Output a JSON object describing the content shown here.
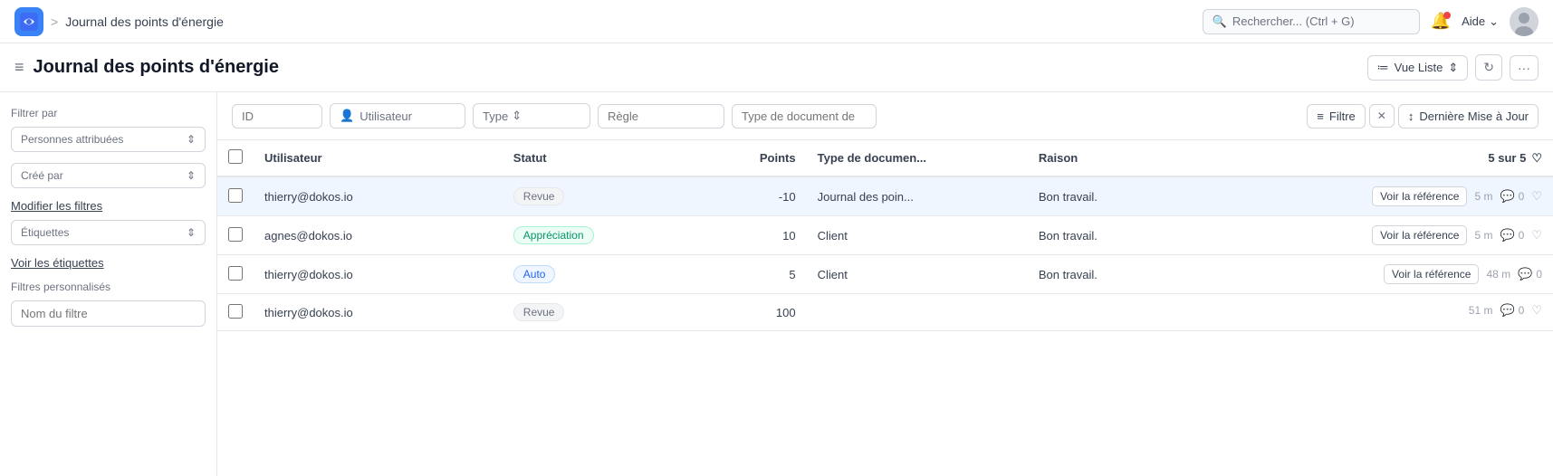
{
  "topnav": {
    "logo_text": "D",
    "breadcrumb_sep": ">",
    "breadcrumb_title": "Journal des points d'énergie",
    "search_placeholder": "Rechercher... (Ctrl + G)",
    "aide_label": "Aide",
    "bell_icon": "🔔",
    "chevron_down": "⌄"
  },
  "page_header": {
    "hamburger": "≡",
    "title": "Journal des points d'énergie",
    "view_btn_icon": "≔",
    "view_btn_label": "Vue Liste",
    "view_btn_chevron": "⇕",
    "refresh_icon": "↻",
    "more_icon": "···"
  },
  "sidebar": {
    "filter_label": "Filtrer par",
    "personne_btn": "Personnes attribuées",
    "personne_chevron": "⇕",
    "cree_par_btn": "Créé par",
    "cree_par_chevron": "⇕",
    "modifier_filtres": "Modifier les filtres",
    "etiquettes_btn": "Étiquettes",
    "etiquettes_chevron": "⇕",
    "voir_etiquettes": "Voir les étiquettes",
    "filtres_perso_label": "Filtres personnalisés",
    "nom_filtre_placeholder": "Nom du filtre"
  },
  "filter_bar": {
    "id_placeholder": "ID",
    "utilisateur_placeholder": "Utilisateur",
    "utilisateur_icon": "👤",
    "type_placeholder": "Type",
    "type_chevron": "⇕",
    "regle_placeholder": "Règle",
    "type_doc_placeholder": "Type de document de",
    "filtre_icon": "≡",
    "filtre_label": "Filtre",
    "close_icon": "✕",
    "sort_icon": "↕",
    "sort_label": "Dernière Mise à Jour"
  },
  "table": {
    "headers": {
      "checkbox": "",
      "utilisateur": "Utilisateur",
      "statut": "Statut",
      "points": "Points",
      "type_document": "Type de documen...",
      "raison": "Raison",
      "count": "5 sur 5",
      "heart": "♡"
    },
    "rows": [
      {
        "id": "row1",
        "checked": false,
        "selected": true,
        "utilisateur": "thierry@dokos.io",
        "statut": "Revue",
        "statut_type": "revue",
        "points": "-10",
        "type_document": "Journal des poin...",
        "raison": "Bon travail.",
        "ref_btn": "Voir la référence",
        "time": "5 m",
        "comments": "0",
        "heart": "♡"
      },
      {
        "id": "row2",
        "checked": false,
        "selected": false,
        "utilisateur": "agnes@dokos.io",
        "statut": "Appréciation",
        "statut_type": "appreciation",
        "points": "10",
        "type_document": "Client",
        "raison": "Bon travail.",
        "ref_btn": "Voir la référence",
        "time": "5 m",
        "comments": "0",
        "heart": "♡"
      },
      {
        "id": "row3",
        "checked": false,
        "selected": false,
        "utilisateur": "thierry@dokos.io",
        "statut": "Auto",
        "statut_type": "auto",
        "points": "5",
        "type_document": "Client",
        "raison": "Bon travail.",
        "ref_btn": "Voir la référence",
        "time": "48 m",
        "comments": "0",
        "heart": ""
      },
      {
        "id": "row4",
        "checked": false,
        "selected": false,
        "utilisateur": "thierry@dokos.io",
        "statut": "Revue",
        "statut_type": "revue",
        "points": "100",
        "type_document": "",
        "raison": "",
        "ref_btn": "",
        "time": "51 m",
        "comments": "0",
        "heart": "♡"
      }
    ]
  }
}
